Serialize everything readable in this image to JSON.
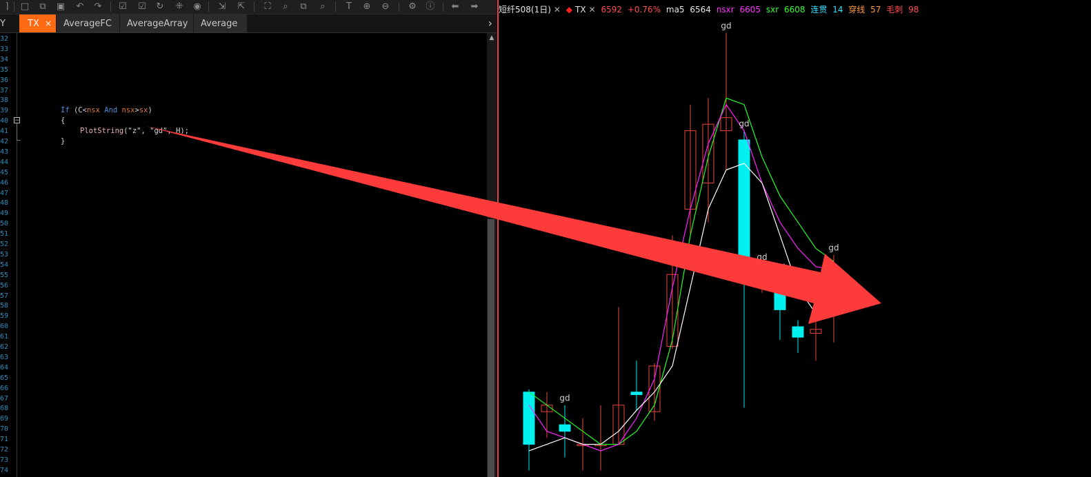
{
  "tabs": {
    "partial_label": "Y",
    "items": [
      {
        "label": "TX",
        "active": true
      },
      {
        "label": "AverageFC",
        "active": false
      },
      {
        "label": "AverageArray",
        "active": false
      },
      {
        "label": "Average",
        "active": false
      }
    ],
    "close_glyph": "×",
    "more_glyph": "›"
  },
  "editor": {
    "line_numbers": [
      "32",
      "33",
      "34",
      "35",
      "36",
      "37",
      "38",
      "39",
      "40",
      "41",
      "42",
      "43",
      "44",
      "45",
      "46",
      "47",
      "48",
      "49",
      "50",
      "51",
      "52",
      "53",
      "54",
      "55",
      "56",
      "57",
      "58",
      "59",
      "60",
      "61",
      "62",
      "63",
      "64",
      "65",
      "66",
      "67",
      "68",
      "69",
      "70",
      "71",
      "72",
      "73",
      "74"
    ],
    "code": {
      "line39_if": "If",
      "line39_paren_open": " (C<",
      "line39_nsx": "nsx",
      "line39_and": " And ",
      "line39_nsx2": "nsx",
      "line39_gt": ">",
      "line39_sx": "sx",
      "line39_close": ")",
      "line40": "{",
      "line41_fn": "PlotString",
      "line41_args": "(\"z\", \"gd\", H);",
      "line42": "}"
    },
    "fold_glyph": "−"
  },
  "chart": {
    "header": {
      "name": "短纤508(1日)",
      "sym_prefix": "◆",
      "symbol": "TX",
      "price": "6592",
      "change": "+0.76%",
      "ma5_label": "ma5",
      "ma5_value": "6564",
      "nsxr_label": "nsxr",
      "nsxr_value": "6605",
      "sxr_label": "sxr",
      "sxr_value": "6608",
      "lianguan_label": "连贯",
      "lianguan_value": "14",
      "chuanxian_label": "穿线",
      "chuanxian_value": "57",
      "maoci_label": "毛刺",
      "maoci_value": "98"
    },
    "signal_label": "gd",
    "colors": {
      "up": "#e8463c",
      "down": "#00f0f0",
      "ma5": "#ffffff",
      "nsx": "#ff22ff",
      "sx": "#22ff22",
      "arrow": "#fe3b3b",
      "header_red": "#ff4d4d",
      "header_white": "#e6e6e6",
      "header_magenta": "#ff33ff",
      "header_green": "#33ff33",
      "header_cyan": "#33e0ff",
      "header_orange": "#ff9a40"
    }
  },
  "chart_data": {
    "type": "candlestick",
    "candles": [
      {
        "open": 6480,
        "close": 6440,
        "high": 6482,
        "low": 6420
      },
      {
        "open": 6465,
        "close": 6470,
        "high": 6480,
        "low": 6445
      },
      {
        "open": 6455,
        "close": 6450,
        "high": 6470,
        "low": 6430
      },
      {
        "open": 6440,
        "close": 6440,
        "high": 6460,
        "low": 6420
      },
      {
        "open": 6440,
        "close": 6440,
        "high": 6470,
        "low": 6420
      },
      {
        "open": 6440,
        "close": 6470,
        "high": 6545,
        "low": 6440
      },
      {
        "open": 6480,
        "close": 6478,
        "high": 6504,
        "low": 6466
      },
      {
        "open": 6465,
        "close": 6500,
        "high": 6502,
        "low": 6458
      },
      {
        "open": 6515,
        "close": 6570,
        "high": 6600,
        "low": 6513
      },
      {
        "open": 6620,
        "close": 6680,
        "high": 6700,
        "low": 6600
      },
      {
        "open": 6640,
        "close": 6685,
        "high": 6705,
        "low": 6610
      },
      {
        "open": 6680,
        "close": 6690,
        "high": 6755,
        "low": 6650
      },
      {
        "open": 6673,
        "close": 6576,
        "high": 6680,
        "low": 6468
      },
      {
        "open": 6576,
        "close": 6577,
        "high": 6578,
        "low": 6556
      },
      {
        "open": 6560,
        "close": 6543,
        "high": 6570,
        "low": 6520
      },
      {
        "open": 6530,
        "close": 6522,
        "high": 6535,
        "low": 6510
      },
      {
        "open": 6525,
        "close": 6528,
        "high": 6556,
        "low": 6504
      },
      {
        "open": 6560,
        "close": 6575,
        "high": 6585,
        "low": 6518
      }
    ],
    "ma5": [
      6435,
      6440,
      6445,
      6440,
      6440,
      6450,
      6466,
      6480,
      6500,
      6560,
      6620,
      6650,
      6655,
      6640,
      6600,
      6560,
      6540,
      6538
    ],
    "nsx": [
      6470,
      6450,
      6445,
      6440,
      6435,
      6440,
      6460,
      6490,
      6560,
      6620,
      6670,
      6700,
      6680,
      6640,
      6610,
      6590,
      6576,
      6574
    ],
    "sx": [
      6480,
      6470,
      6460,
      6450,
      6440,
      6440,
      6450,
      6470,
      6520,
      6600,
      6660,
      6705,
      6700,
      6660,
      6630,
      6610,
      6590,
      6580
    ],
    "signals": [
      2,
      11,
      12,
      13,
      14,
      17
    ]
  }
}
